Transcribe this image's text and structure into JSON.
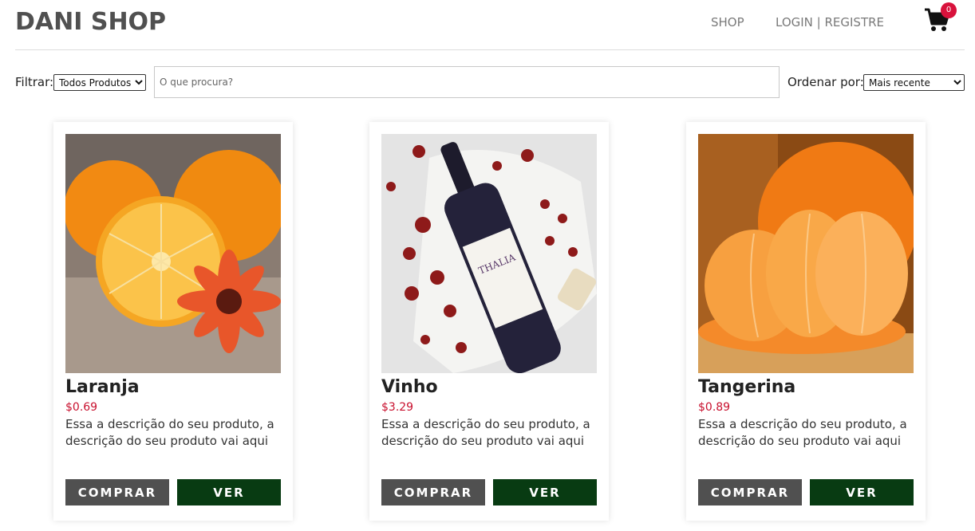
{
  "header": {
    "brand": "DANI SHOP",
    "nav_shop": "SHOP",
    "nav_login": "LOGIN | REGISTRE",
    "cart_count": "0"
  },
  "filters": {
    "filter_label": "Filtrar:",
    "filter_selected": "Todos Produtos",
    "search_placeholder": "O que procura?",
    "order_label": "Ordenar por:",
    "order_selected": "Mais recente"
  },
  "products": [
    {
      "name": "Laranja",
      "price": "$0.69",
      "description": "Essa a descrição do seu produto, a descrição do seu produto vai aqui",
      "buy_label": "COMPRAR",
      "view_label": "VER"
    },
    {
      "name": "Vinho",
      "price": "$3.29",
      "description": "Essa a descrição do seu produto, a descrição do seu produto vai aqui",
      "buy_label": "COMPRAR",
      "view_label": "VER"
    },
    {
      "name": "Tangerina",
      "price": "$0.89",
      "description": "Essa a descrição do seu produto, a descrição do seu produto vai aqui",
      "buy_label": "COMPRAR",
      "view_label": "VER"
    }
  ],
  "wine_label": "THALIA",
  "colors": {
    "price": "#c8102e",
    "buy_button": "#505050",
    "view_button": "#083b12",
    "badge": "#d8123c"
  },
  "icons": {
    "cart": "shopping-cart-icon"
  }
}
